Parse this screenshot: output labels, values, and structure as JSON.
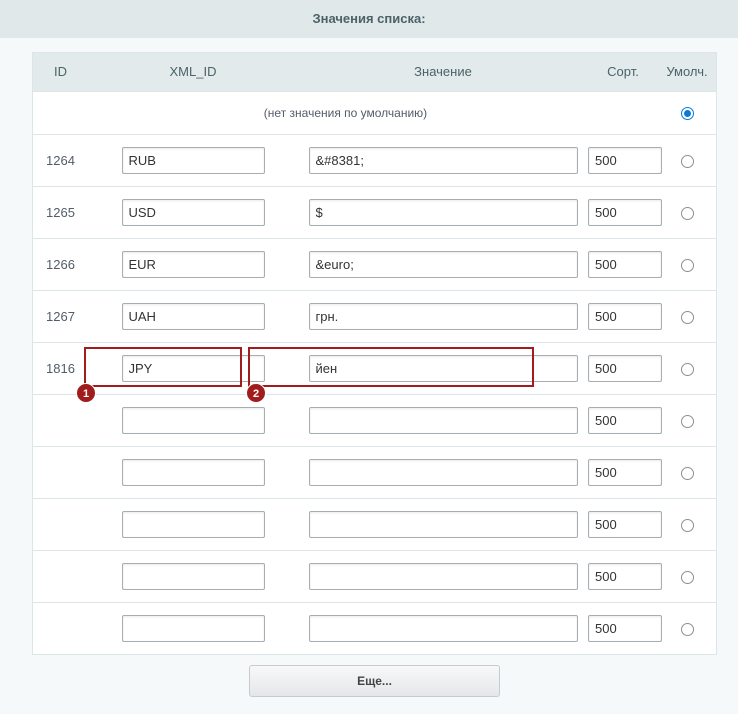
{
  "section_title": "Значения списка:",
  "columns": {
    "id": "ID",
    "xml_id": "XML_ID",
    "value": "Значение",
    "sort": "Сорт.",
    "default": "Умолч."
  },
  "default_row": {
    "label": "(нет значения по умолчанию)",
    "checked": true
  },
  "rows": [
    {
      "id": "1264",
      "xml_id": "RUB",
      "value": "&#8381;",
      "sort": "500"
    },
    {
      "id": "1265",
      "xml_id": "USD",
      "value": "$",
      "sort": "500"
    },
    {
      "id": "1266",
      "xml_id": "EUR",
      "value": "&euro;",
      "sort": "500"
    },
    {
      "id": "1267",
      "xml_id": "UAH",
      "value": "грн.",
      "sort": "500"
    },
    {
      "id": "1816",
      "xml_id": "JPY",
      "value": "йен",
      "sort": "500"
    },
    {
      "id": "",
      "xml_id": "",
      "value": "",
      "sort": "500"
    },
    {
      "id": "",
      "xml_id": "",
      "value": "",
      "sort": "500"
    },
    {
      "id": "",
      "xml_id": "",
      "value": "",
      "sort": "500"
    },
    {
      "id": "",
      "xml_id": "",
      "value": "",
      "sort": "500"
    },
    {
      "id": "",
      "xml_id": "",
      "value": "",
      "sort": "500"
    }
  ],
  "annotations": [
    "1",
    "2"
  ],
  "more_button": "Еще..."
}
